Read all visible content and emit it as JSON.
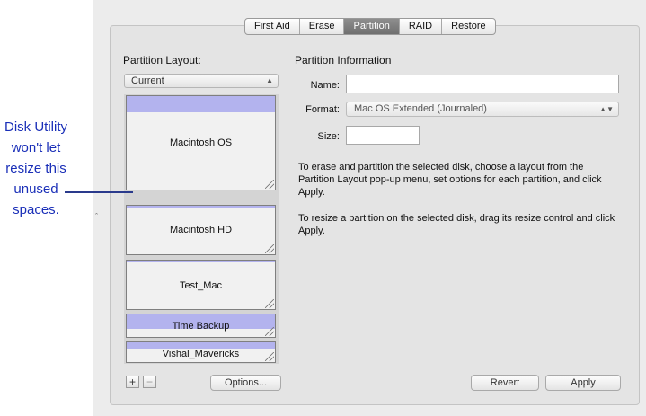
{
  "annotation": {
    "text": "Disk Utility won't let resize this unused spaces."
  },
  "tabs": [
    "First Aid",
    "Erase",
    "Partition",
    "RAID",
    "Restore"
  ],
  "active_tab": "Partition",
  "layout": {
    "title": "Partition Layout:",
    "popup_value": "Current",
    "partitions": [
      "Macintosh OS",
      "Macintosh HD",
      "Test_Mac",
      "Time Backup",
      "Vishal_Mavericks"
    ]
  },
  "buttons": {
    "add": "+",
    "remove": "−",
    "options": "Options...",
    "revert": "Revert",
    "apply": "Apply"
  },
  "info": {
    "title": "Partition Information",
    "name_label": "Name:",
    "name_value": "",
    "format_label": "Format:",
    "format_value": "Mac OS Extended (Journaled)",
    "size_label": "Size:",
    "size_value": "",
    "help1": "To erase and partition the selected disk, choose a layout from the Partition Layout pop-up menu, set options for each partition, and click Apply.",
    "help2": "To resize a partition on the selected disk, drag its resize control and click Apply."
  }
}
